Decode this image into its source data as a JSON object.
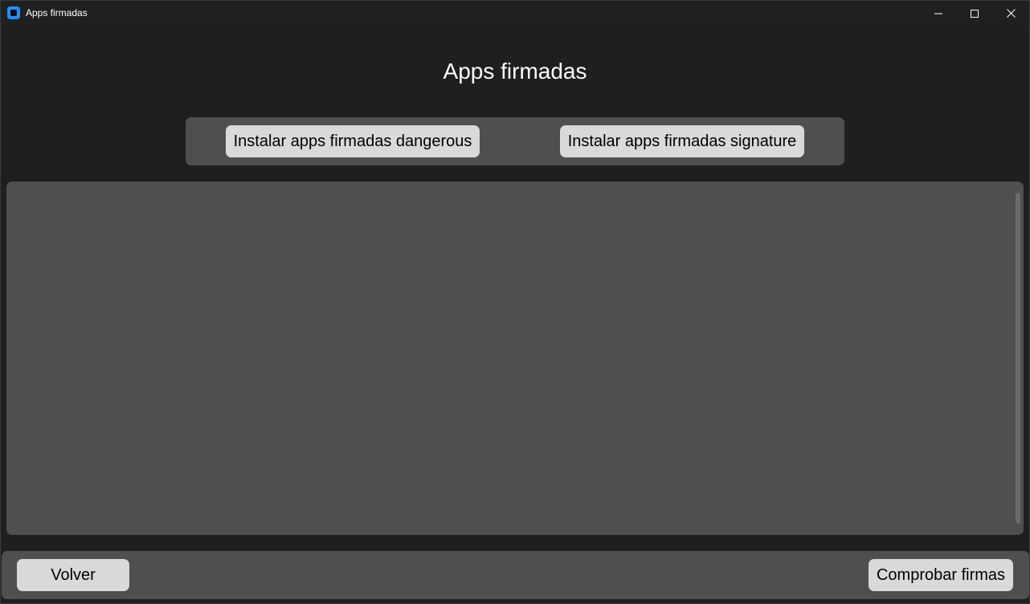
{
  "window": {
    "title": "Apps firmadas",
    "controls": {
      "minimize_icon": "minimize-icon",
      "maximize_icon": "maximize-icon",
      "close_icon": "close-icon"
    }
  },
  "header": {
    "title": "Apps firmadas"
  },
  "actions": {
    "install_dangerous_label": "Instalar apps firmadas dangerous",
    "install_signature_label": "Instalar apps firmadas signature"
  },
  "output": {
    "text": ""
  },
  "footer": {
    "back_label": "Volver",
    "check_label": "Comprobar firmas"
  },
  "colors": {
    "background": "#1f1f1f",
    "frame": "#4f4f4f",
    "button": "#d9d9d9",
    "app_icon": "#1e90ff"
  }
}
